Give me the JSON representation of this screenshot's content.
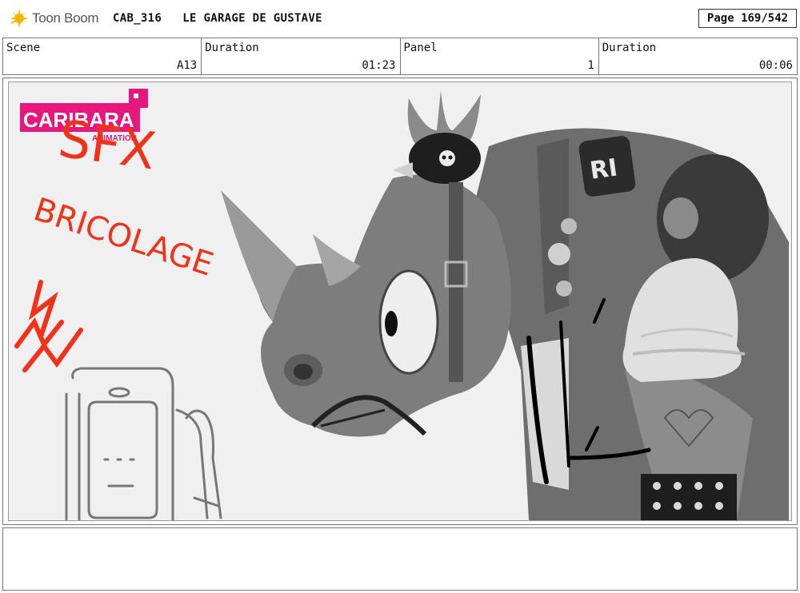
{
  "header": {
    "logo_text": "Toon Boom",
    "project_code": "CAB_316",
    "episode_title": "LE GARAGE DE GUSTAVE",
    "page_label": "Page 169/542"
  },
  "info": {
    "scene_label": "Scene",
    "scene_value": "A13",
    "scene_duration_label": "Duration",
    "scene_duration_value": "01:23",
    "panel_label": "Panel",
    "panel_value": "1",
    "panel_duration_label": "Duration",
    "panel_duration_value": "00:06"
  },
  "panel": {
    "studio_logo_line1": "CARIBARA",
    "studio_logo_line2": "ANIMATION",
    "sketch_text_1": "SFX",
    "sketch_text_2": "BRICOLAGE",
    "jacket_patch_text": "RI",
    "colors": {
      "studio_pink": "#e8177d",
      "sketch_red": "#f0321a"
    }
  },
  "notes": {
    "text": ""
  }
}
